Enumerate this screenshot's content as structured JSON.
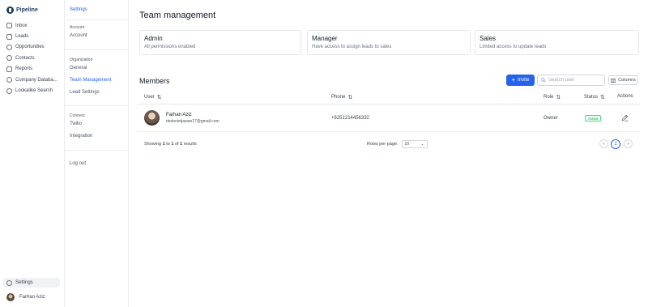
{
  "app": {
    "name": "Pipeline"
  },
  "nav": {
    "items": [
      {
        "label": "Inbox",
        "icon": "inbox-icon"
      },
      {
        "label": "Leads",
        "icon": "leads-icon"
      },
      {
        "label": "Opportunities",
        "icon": "opportunities-icon"
      },
      {
        "label": "Contacts",
        "icon": "contacts-icon"
      },
      {
        "label": "Reports",
        "icon": "reports-icon"
      },
      {
        "label": "Company Databa...",
        "icon": "database-icon"
      },
      {
        "label": "Lookalike Search",
        "icon": "search-icon"
      }
    ],
    "settings_label": "Settings",
    "user_name": "Farhan Aziz"
  },
  "sidebar": {
    "header": "Settings",
    "account_group": "Account",
    "account_link": "Account",
    "organization_group": "Organization",
    "general_link": "General",
    "team_link": "Team Management",
    "lead_settings_link": "Lead Settings",
    "connect_group": "Connect",
    "twilio_link": "Twilio",
    "integration_link": "Integration",
    "logout_link": "Log out"
  },
  "main": {
    "title": "Team management",
    "roles": [
      {
        "name": "Admin",
        "description": "All permissions enabled"
      },
      {
        "name": "Manager",
        "description": "Have access to assign leads to sales"
      },
      {
        "name": "Sales",
        "description": "Limited access to update leads"
      }
    ],
    "members_title": "Members",
    "invite_label": "Invite",
    "search_placeholder": "Search user",
    "columns_label": "Columns",
    "table": {
      "headers": {
        "user": "User",
        "phone": "Phone",
        "role": "Role",
        "status": "Status",
        "actions": "Actions"
      },
      "rows": [
        {
          "name": "Farhan Aziz",
          "email": "dedenietjawan17@gmail.com",
          "phone": "+6251214456332",
          "role": "Owner",
          "status": "Active"
        }
      ]
    },
    "pagination": {
      "showing_prefix": "Showing",
      "from": "1",
      "to_word": "to",
      "to": "1",
      "of_word": "of",
      "total": "1",
      "suffix": "results",
      "rows_per_page_label": "Rows per page:",
      "rows_per_page_value": "10",
      "current_page": "1"
    }
  },
  "colors": {
    "accent": "#2563eb",
    "active_status": "#16a34a"
  }
}
